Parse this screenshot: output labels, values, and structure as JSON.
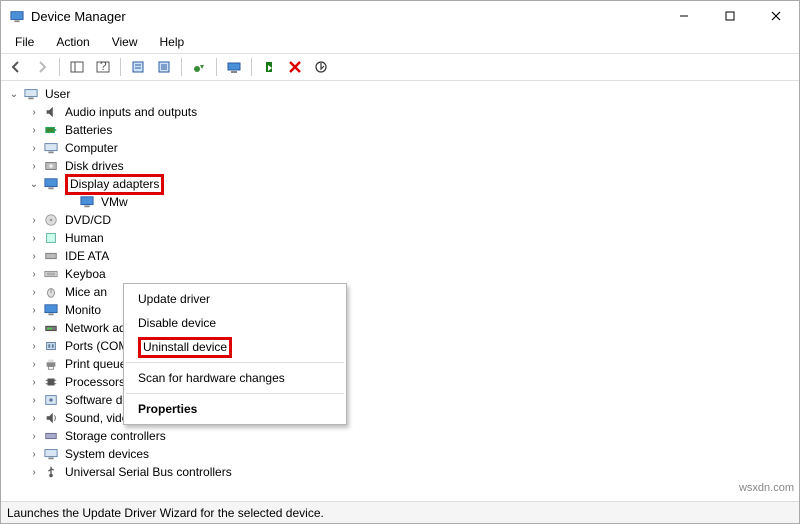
{
  "window": {
    "title": "Device Manager"
  },
  "menubar": {
    "file": "File",
    "action": "Action",
    "view": "View",
    "help": "Help"
  },
  "tree": {
    "root": "User",
    "items": [
      "Audio inputs and outputs",
      "Batteries",
      "Computer",
      "Disk drives",
      "Display adapters",
      "DVD/CD",
      "Human",
      "IDE ATA",
      "Keyboa",
      "Mice an",
      "Monito",
      "Network adapters",
      "Ports (COM & LPT)",
      "Print queues",
      "Processors",
      "Software devices",
      "Sound, video and game controllers",
      "Storage controllers",
      "System devices",
      "Universal Serial Bus controllers"
    ],
    "display_child": "VMw"
  },
  "context_menu": {
    "update": "Update driver",
    "disable": "Disable device",
    "uninstall": "Uninstall device",
    "scan": "Scan for hardware changes",
    "properties": "Properties"
  },
  "statusbar": {
    "text": "Launches the Update Driver Wizard for the selected device."
  },
  "watermark": "wsxdn.com"
}
